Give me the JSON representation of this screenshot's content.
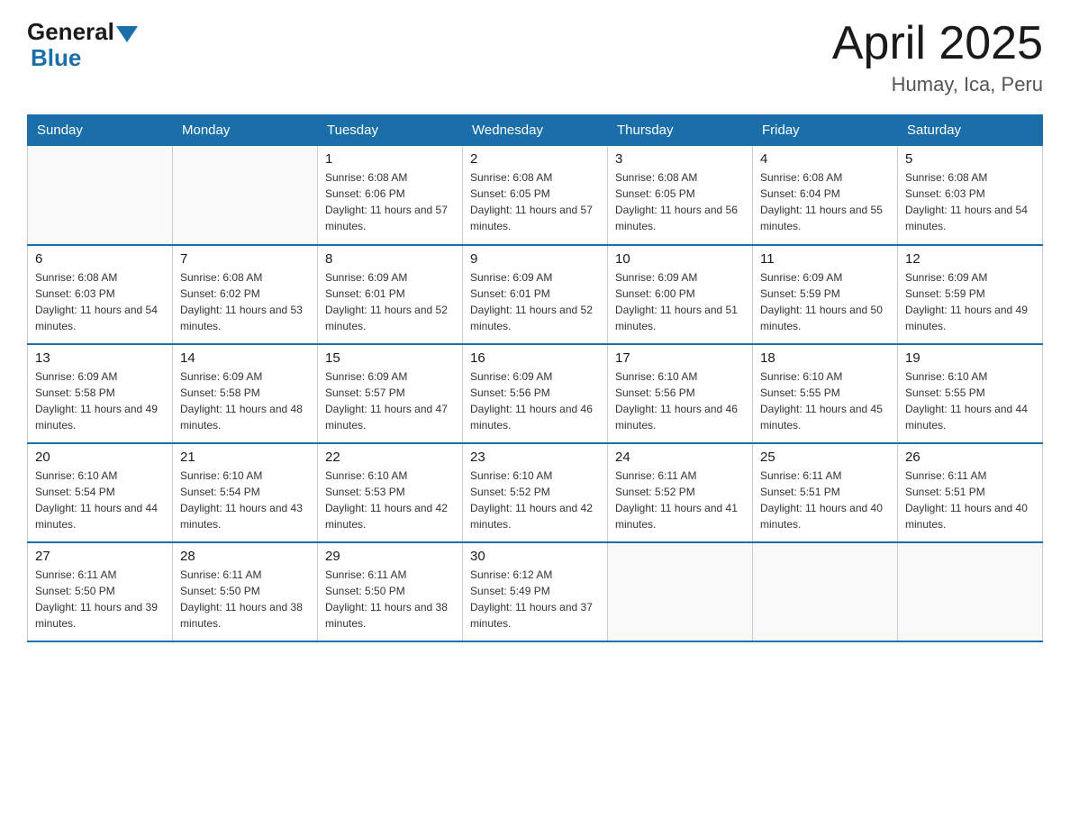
{
  "header": {
    "logo_general": "General",
    "logo_blue": "Blue",
    "title": "April 2025",
    "subtitle": "Humay, Ica, Peru"
  },
  "days_of_week": [
    "Sunday",
    "Monday",
    "Tuesday",
    "Wednesday",
    "Thursday",
    "Friday",
    "Saturday"
  ],
  "weeks": [
    {
      "days": [
        {
          "num": "",
          "empty": true
        },
        {
          "num": "",
          "empty": true
        },
        {
          "num": "1",
          "sunrise": "6:08 AM",
          "sunset": "6:06 PM",
          "daylight": "11 hours and 57 minutes."
        },
        {
          "num": "2",
          "sunrise": "6:08 AM",
          "sunset": "6:05 PM",
          "daylight": "11 hours and 57 minutes."
        },
        {
          "num": "3",
          "sunrise": "6:08 AM",
          "sunset": "6:05 PM",
          "daylight": "11 hours and 56 minutes."
        },
        {
          "num": "4",
          "sunrise": "6:08 AM",
          "sunset": "6:04 PM",
          "daylight": "11 hours and 55 minutes."
        },
        {
          "num": "5",
          "sunrise": "6:08 AM",
          "sunset": "6:03 PM",
          "daylight": "11 hours and 54 minutes."
        }
      ]
    },
    {
      "days": [
        {
          "num": "6",
          "sunrise": "6:08 AM",
          "sunset": "6:03 PM",
          "daylight": "11 hours and 54 minutes."
        },
        {
          "num": "7",
          "sunrise": "6:08 AM",
          "sunset": "6:02 PM",
          "daylight": "11 hours and 53 minutes."
        },
        {
          "num": "8",
          "sunrise": "6:09 AM",
          "sunset": "6:01 PM",
          "daylight": "11 hours and 52 minutes."
        },
        {
          "num": "9",
          "sunrise": "6:09 AM",
          "sunset": "6:01 PM",
          "daylight": "11 hours and 52 minutes."
        },
        {
          "num": "10",
          "sunrise": "6:09 AM",
          "sunset": "6:00 PM",
          "daylight": "11 hours and 51 minutes."
        },
        {
          "num": "11",
          "sunrise": "6:09 AM",
          "sunset": "5:59 PM",
          "daylight": "11 hours and 50 minutes."
        },
        {
          "num": "12",
          "sunrise": "6:09 AM",
          "sunset": "5:59 PM",
          "daylight": "11 hours and 49 minutes."
        }
      ]
    },
    {
      "days": [
        {
          "num": "13",
          "sunrise": "6:09 AM",
          "sunset": "5:58 PM",
          "daylight": "11 hours and 49 minutes."
        },
        {
          "num": "14",
          "sunrise": "6:09 AM",
          "sunset": "5:58 PM",
          "daylight": "11 hours and 48 minutes."
        },
        {
          "num": "15",
          "sunrise": "6:09 AM",
          "sunset": "5:57 PM",
          "daylight": "11 hours and 47 minutes."
        },
        {
          "num": "16",
          "sunrise": "6:09 AM",
          "sunset": "5:56 PM",
          "daylight": "11 hours and 46 minutes."
        },
        {
          "num": "17",
          "sunrise": "6:10 AM",
          "sunset": "5:56 PM",
          "daylight": "11 hours and 46 minutes."
        },
        {
          "num": "18",
          "sunrise": "6:10 AM",
          "sunset": "5:55 PM",
          "daylight": "11 hours and 45 minutes."
        },
        {
          "num": "19",
          "sunrise": "6:10 AM",
          "sunset": "5:55 PM",
          "daylight": "11 hours and 44 minutes."
        }
      ]
    },
    {
      "days": [
        {
          "num": "20",
          "sunrise": "6:10 AM",
          "sunset": "5:54 PM",
          "daylight": "11 hours and 44 minutes."
        },
        {
          "num": "21",
          "sunrise": "6:10 AM",
          "sunset": "5:54 PM",
          "daylight": "11 hours and 43 minutes."
        },
        {
          "num": "22",
          "sunrise": "6:10 AM",
          "sunset": "5:53 PM",
          "daylight": "11 hours and 42 minutes."
        },
        {
          "num": "23",
          "sunrise": "6:10 AM",
          "sunset": "5:52 PM",
          "daylight": "11 hours and 42 minutes."
        },
        {
          "num": "24",
          "sunrise": "6:11 AM",
          "sunset": "5:52 PM",
          "daylight": "11 hours and 41 minutes."
        },
        {
          "num": "25",
          "sunrise": "6:11 AM",
          "sunset": "5:51 PM",
          "daylight": "11 hours and 40 minutes."
        },
        {
          "num": "26",
          "sunrise": "6:11 AM",
          "sunset": "5:51 PM",
          "daylight": "11 hours and 40 minutes."
        }
      ]
    },
    {
      "days": [
        {
          "num": "27",
          "sunrise": "6:11 AM",
          "sunset": "5:50 PM",
          "daylight": "11 hours and 39 minutes."
        },
        {
          "num": "28",
          "sunrise": "6:11 AM",
          "sunset": "5:50 PM",
          "daylight": "11 hours and 38 minutes."
        },
        {
          "num": "29",
          "sunrise": "6:11 AM",
          "sunset": "5:50 PM",
          "daylight": "11 hours and 38 minutes."
        },
        {
          "num": "30",
          "sunrise": "6:12 AM",
          "sunset": "5:49 PM",
          "daylight": "11 hours and 37 minutes."
        },
        {
          "num": "",
          "empty": true
        },
        {
          "num": "",
          "empty": true
        },
        {
          "num": "",
          "empty": true
        }
      ]
    }
  ],
  "colors": {
    "header_bg": "#1a6fa8",
    "accent": "#1a6fa8"
  }
}
